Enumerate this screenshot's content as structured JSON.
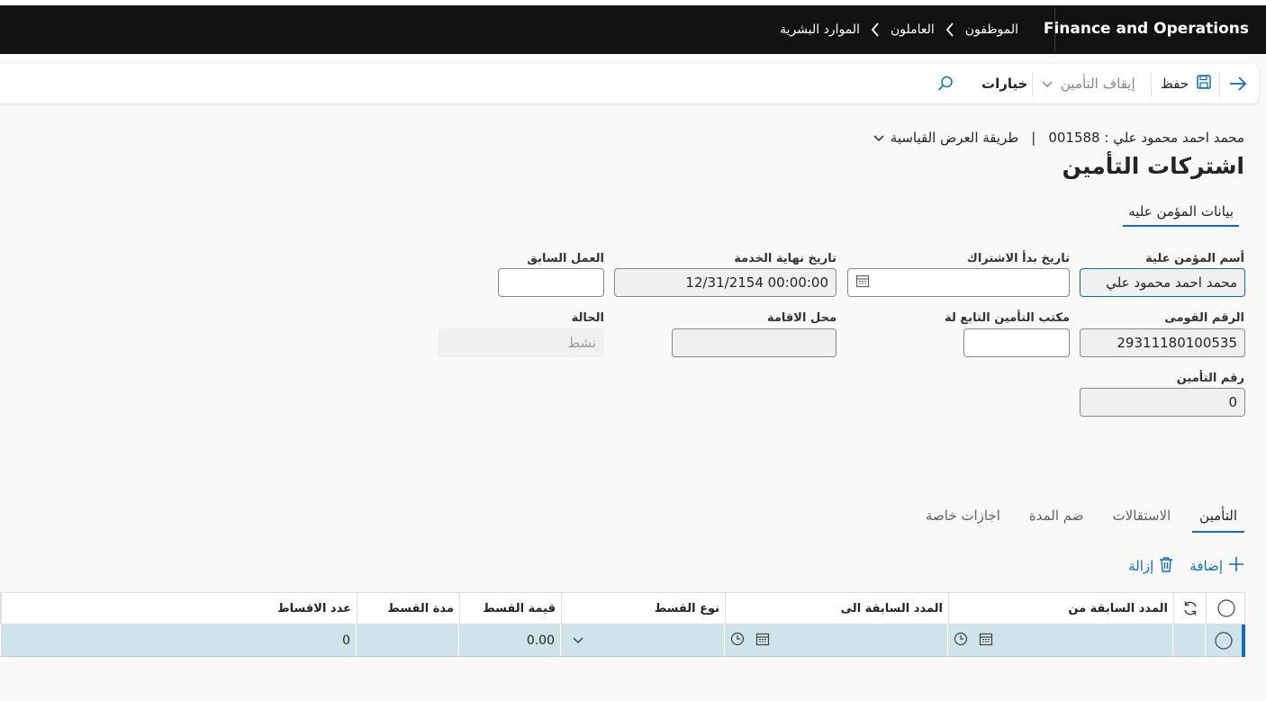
{
  "topbar": {
    "app_title": "Finance and Operations",
    "breadcrumb": [
      "الموارد البشرية",
      "العاملون",
      "الموظفون"
    ]
  },
  "actionbar": {
    "save_label": "حفظ",
    "stop_insurance_label": "إيقاف التأمين",
    "options_label": "خيارات"
  },
  "header": {
    "record": "محمد احمد محمود علي : 001588",
    "separator": "|",
    "view": "طريقة العرض القياسية"
  },
  "page_title": "اشتركات التأمين",
  "section_tab": "بيانات المؤمن عليه",
  "fields": {
    "insured_name": {
      "label": "أسم المؤمن علية",
      "value": "محمد احمد محمود علي"
    },
    "subscription_start": {
      "label": "تاريخ بدأ الاشتراك",
      "value": ""
    },
    "service_end": {
      "label": "تاريخ نهاية الخدمة",
      "value": "12/31/2154 00:00:00"
    },
    "previous_work": {
      "label": "العمل السابق",
      "value": ""
    },
    "national_id": {
      "label": "الرقم القومى",
      "value": "29311180100535"
    },
    "insurance_office": {
      "label": "مكتب التأمين التابع لة",
      "value": ""
    },
    "residence": {
      "label": "محل الاقامة",
      "value": ""
    },
    "status": {
      "label": "الحالة",
      "value": "نشط"
    },
    "insurance_number": {
      "label": "رقم التأمين",
      "value": "0"
    }
  },
  "tabs": [
    "التأمين",
    "الاستقالات",
    "ضم المدة",
    "اجازات خاصة"
  ],
  "grid_toolbar": {
    "add_label": "إضافة",
    "remove_label": "إزالة"
  },
  "grid": {
    "columns": [
      "المدد السابقة من",
      "المدد السابقة الى",
      "نوع القسط",
      "قيمة القسط",
      "مدة القسط",
      "عدد الاقساط"
    ],
    "row": {
      "installment_value": "0.00",
      "installments_count": "0"
    }
  },
  "colors": {
    "accent": "#0f6cbd",
    "topbar": "#121212",
    "selected_row": "#cfe4ea"
  }
}
